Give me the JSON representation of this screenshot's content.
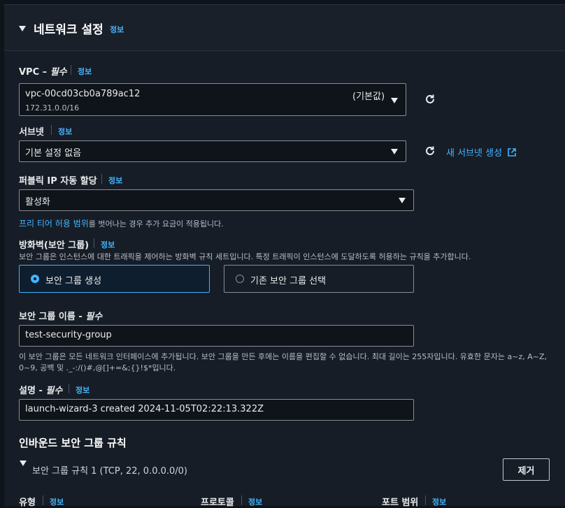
{
  "section": {
    "title": "네트워크 설정",
    "info": "정보"
  },
  "vpc": {
    "label": "VPC –",
    "required": "필수",
    "info": "정보",
    "value": "vpc-00cd03cb0a789ac12",
    "cidr": "172.31.0.0/16",
    "badge": "(기본값)"
  },
  "subnet": {
    "label": "서브넷",
    "info": "정보",
    "value": "기본 설정 없음",
    "new_link": "새 서브넷 생성"
  },
  "public_ip": {
    "label": "퍼블릭 IP 자동 할당",
    "info": "정보",
    "value": "활성화",
    "note_link": "프리 티어 허용 범위",
    "note_rest": "를 벗어나는 경우 추가 요금이 적용됩니다."
  },
  "firewall": {
    "label": "방화벽(보안 그룹)",
    "info": "정보",
    "desc": "보안 그룹은 인스턴스에 대한 트래픽을 제어하는 방화벽 규칙 세트입니다. 특정 트래픽이 인스턴스에 도달하도록 허용하는 규칙을 추가합니다.",
    "option_create": "보안 그룹 생성",
    "option_existing": "기존 보안 그룹 선택",
    "selected": "create"
  },
  "sg_name": {
    "label": "보안 그룹 이름 -",
    "required": "필수",
    "value": "test-security-group",
    "help_line1": "이 보안 그룹은 모든 네트워크 인터페이스에 추가됩니다. 보안 그룹을 만든 후에는 이름을 편집할 수 없습니다. 최대 길이는 255자입니다. 유효한 문자는 a~z, A~Z,",
    "help_line2": "0~9, 공백 및 ._-:/()#,@[]+=&;{}!$*입니다."
  },
  "description": {
    "label": "설명 -",
    "required": "필수",
    "info": "정보",
    "value": "launch-wizard-3 created 2024-11-05T02:22:13.322Z"
  },
  "inbound": {
    "title": "인바운드 보안 그룹 규칙",
    "rule_title": "보안 그룹 규칙 1 (TCP, 22, 0.0.0.0/0)",
    "remove_button": "제거",
    "col_type": "유형",
    "col_protocol": "프로토콜",
    "col_port": "포트 범위",
    "info": "정보"
  },
  "colors": {
    "accent": "#42b4ff",
    "selected_card_bg": "#0f1e2e",
    "selected_card_border": "#42b4ff"
  }
}
